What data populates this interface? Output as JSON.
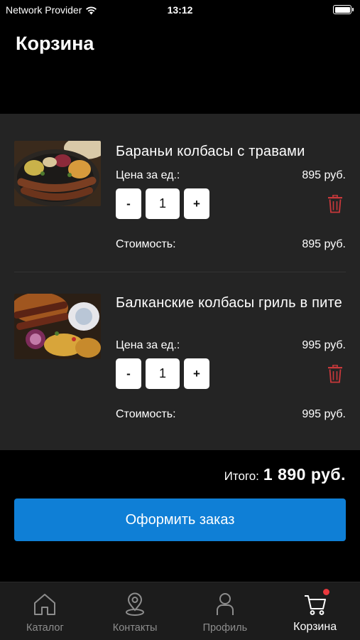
{
  "status_bar": {
    "carrier": "Network Provider",
    "time": "13:12",
    "battery_level": 1.0
  },
  "header": {
    "title": "Корзина"
  },
  "cart": {
    "items": [
      {
        "name": "Бараньи колбасы с травами",
        "unit_price_label": "Цена за ед.:",
        "unit_price": "895 руб.",
        "quantity": "1",
        "cost_label": "Стоимость:",
        "cost": "895 руб.",
        "minus_label": "-",
        "plus_label": "+"
      },
      {
        "name": "Балканские колбасы гриль в пите",
        "unit_price_label": "Цена за ед.:",
        "unit_price": "995 руб.",
        "quantity": "1",
        "cost_label": "Стоимость:",
        "cost": "995 руб.",
        "minus_label": "-",
        "plus_label": "+"
      }
    ]
  },
  "summary": {
    "total_label": "Итого:",
    "total_value": "1 890 руб."
  },
  "checkout": {
    "label": "Оформить заказ"
  },
  "tabbar": {
    "tabs": [
      {
        "label": "Каталог",
        "icon": "home-icon"
      },
      {
        "label": "Контакты",
        "icon": "location-pin-icon"
      },
      {
        "label": "Профиль",
        "icon": "person-icon"
      },
      {
        "label": "Корзина",
        "icon": "cart-icon"
      }
    ],
    "active_tab": "Корзина"
  },
  "colors": {
    "background": "#000000",
    "panel": "#242424",
    "accent": "#0f7fd6",
    "delete": "#c8383b",
    "badge": "#e8383d"
  }
}
